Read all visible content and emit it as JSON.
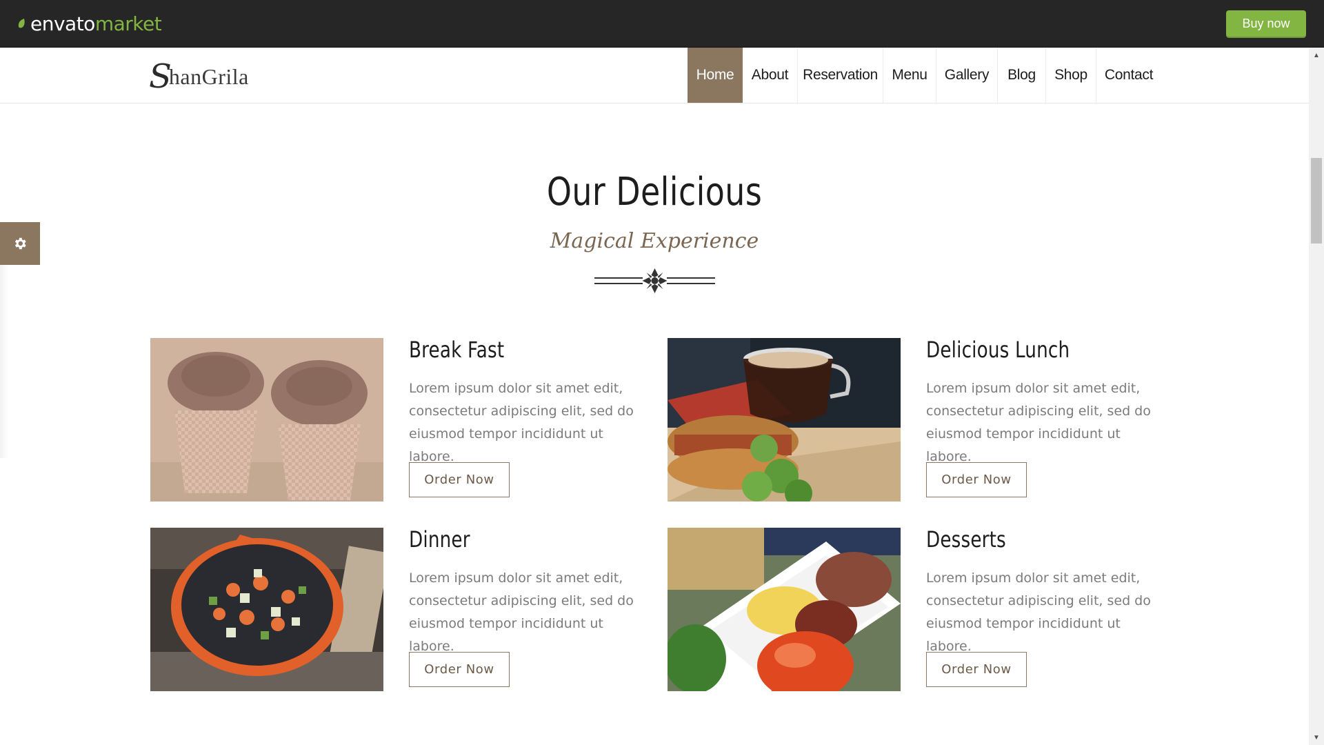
{
  "envato": {
    "logo_word1": "envato",
    "logo_word2": "market",
    "buy_label": "Buy now",
    "accent": "#82b541"
  },
  "brand": {
    "initial": "S",
    "rest": "hanGrila"
  },
  "nav": {
    "items": [
      {
        "label": "Home",
        "active": true
      },
      {
        "label": "About"
      },
      {
        "label": "Reservation"
      },
      {
        "label": "Menu"
      },
      {
        "label": "Gallery"
      },
      {
        "label": "Blog"
      },
      {
        "label": "Shop"
      },
      {
        "label": "Contact"
      }
    ],
    "active_color": "#8b7760"
  },
  "section": {
    "title": "Our Delicious",
    "subtitle": "Magical Experience"
  },
  "cards": [
    {
      "title": "Break Fast",
      "desc": "Lorem ipsum dolor sit amet edit, consectetur adipiscing elit, sed do eiusmod tempor incididunt ut labore.",
      "button": "Order Now",
      "image": "cupcakes-photo"
    },
    {
      "title": "Delicious Lunch",
      "desc": "Lorem ipsum dolor sit amet edit, consectetur adipiscing elit, sed do eiusmod tempor incididunt ut labore.",
      "button": "Order Now",
      "image": "coffee-sandwich-photo"
    },
    {
      "title": "Dinner",
      "desc": "Lorem ipsum dolor sit amet edit, consectetur adipiscing elit, sed do eiusmod tempor incididunt ut labore.",
      "button": "Order Now",
      "image": "pan-vegetables-photo"
    },
    {
      "title": "Desserts",
      "desc": "Lorem ipsum dolor sit amet edit, consectetur adipiscing elit, sed do eiusmod tempor incididunt ut labore.",
      "button": "Order Now",
      "image": "rice-plate-photo"
    }
  ],
  "icons": {
    "settings": "gear-icon",
    "scroll_up": "triangle-up-icon",
    "scroll_down": "triangle-down-icon"
  }
}
